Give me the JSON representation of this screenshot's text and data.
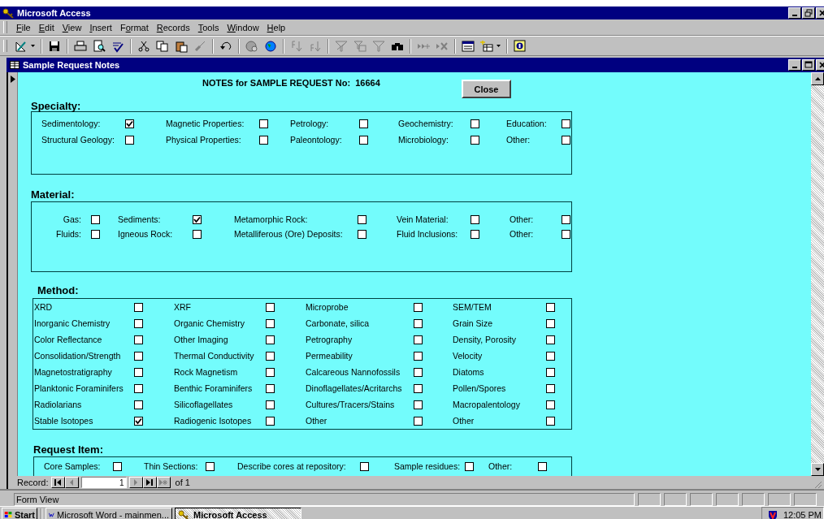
{
  "window": {
    "title": "Microsoft Access"
  },
  "menu": [
    {
      "mnemonic": "F",
      "after": "ile"
    },
    {
      "mnemonic": "E",
      "after": "dit"
    },
    {
      "mnemonic": "V",
      "after": "iew"
    },
    {
      "mnemonic": "I",
      "after": "nsert"
    },
    {
      "before": "F",
      "mnemonic": "o",
      "after": "rmat"
    },
    {
      "mnemonic": "R",
      "after": "ecords"
    },
    {
      "mnemonic": "T",
      "after": "ools"
    },
    {
      "mnemonic": "W",
      "after": "indow"
    },
    {
      "mnemonic": "H",
      "after": "elp"
    }
  ],
  "form_window": {
    "title": "Sample Request Notes"
  },
  "form": {
    "heading": "NOTES for SAMPLE REQUEST No:  16664",
    "close_button": "Close",
    "sections": [
      {
        "title": "Specialty:",
        "items": [
          {
            "label": "Sedimentology:",
            "checked": true
          },
          {
            "label": "Magnetic Properties:",
            "checked": false
          },
          {
            "label": "Petrology:",
            "checked": false
          },
          {
            "label": "Geochemistry:",
            "checked": false
          },
          {
            "label": "Education:",
            "checked": false
          },
          {
            "label": "Structural Geology:",
            "checked": false
          },
          {
            "label": "Physical Properties:",
            "checked": false
          },
          {
            "label": "Paleontology:",
            "checked": false
          },
          {
            "label": "Microbiology:",
            "checked": false
          },
          {
            "label": "Other:",
            "checked": false
          }
        ]
      },
      {
        "title": "Material:",
        "items": [
          {
            "label": "Gas:",
            "checked": false
          },
          {
            "label": "Sediments:",
            "checked": true
          },
          {
            "label": "Metamorphic Rock:",
            "checked": false
          },
          {
            "label": "Vein Material:",
            "checked": false
          },
          {
            "label": "Other:",
            "checked": false
          },
          {
            "label": "Fluids:",
            "checked": false
          },
          {
            "label": "Igneous Rock:",
            "checked": false
          },
          {
            "label": "Metalliferous (Ore) Deposits:",
            "checked": false
          },
          {
            "label": "Fluid Inclusions:",
            "checked": false
          },
          {
            "label": "Other:",
            "checked": false
          }
        ]
      },
      {
        "title": "Method:",
        "items": [
          {
            "label": "XRD",
            "checked": false
          },
          {
            "label": "XRF",
            "checked": false
          },
          {
            "label": "Microprobe",
            "checked": false
          },
          {
            "label": "SEM/TEM",
            "checked": false
          },
          {
            "label": "Inorganic Chemistry",
            "checked": false
          },
          {
            "label": "Organic Chemistry",
            "checked": false
          },
          {
            "label": "Carbonate, silica",
            "checked": false
          },
          {
            "label": "Grain Size",
            "checked": false
          },
          {
            "label": "Color Reflectance",
            "checked": false
          },
          {
            "label": "Other Imaging",
            "checked": false
          },
          {
            "label": "Petrography",
            "checked": false
          },
          {
            "label": "Density, Porosity",
            "checked": false
          },
          {
            "label": "Consolidation/Strength",
            "checked": false
          },
          {
            "label": "Thermal Conductivity",
            "checked": false
          },
          {
            "label": "Permeability",
            "checked": false
          },
          {
            "label": "Velocity",
            "checked": false
          },
          {
            "label": "Magnetostratigraphy",
            "checked": false
          },
          {
            "label": "Rock Magnetism",
            "checked": false
          },
          {
            "label": "Calcareous Nannofossils",
            "checked": false
          },
          {
            "label": "Diatoms",
            "checked": false
          },
          {
            "label": "Planktonic Foraminifers",
            "checked": false
          },
          {
            "label": "Benthic Foraminifers",
            "checked": false
          },
          {
            "label": "Dinoflagellates/Acritarchs",
            "checked": false
          },
          {
            "label": "Pollen/Spores",
            "checked": false
          },
          {
            "label": "Radiolarians",
            "checked": false
          },
          {
            "label": "Silicoflagellates",
            "checked": false
          },
          {
            "label": "Cultures/Tracers/Stains",
            "checked": false
          },
          {
            "label": "Macropalentology",
            "checked": false
          },
          {
            "label": "Stable Isotopes",
            "checked": true
          },
          {
            "label": "Radiogenic Isotopes",
            "checked": false
          },
          {
            "label": "Other",
            "checked": false
          },
          {
            "label": "Other",
            "checked": false
          }
        ]
      },
      {
        "title": "Request Item:",
        "items": [
          {
            "label": "Core Samples:",
            "checked": false
          },
          {
            "label": "Thin Sections:",
            "checked": false
          },
          {
            "label": "Describe cores at repository:",
            "checked": false
          },
          {
            "label": "Sample residues:",
            "checked": false
          },
          {
            "label": "Other:",
            "checked": false
          }
        ]
      }
    ]
  },
  "record_nav": {
    "label": "Record:",
    "current": "1",
    "total": "of 1"
  },
  "status_bar": {
    "text": "Form View"
  },
  "taskbar": {
    "start": "Start",
    "tasks": [
      {
        "label": "Microsoft Word - mainmen...",
        "selected": false
      },
      {
        "label": "Microsoft Access",
        "selected": true
      }
    ],
    "clock": "12:05 PM"
  }
}
